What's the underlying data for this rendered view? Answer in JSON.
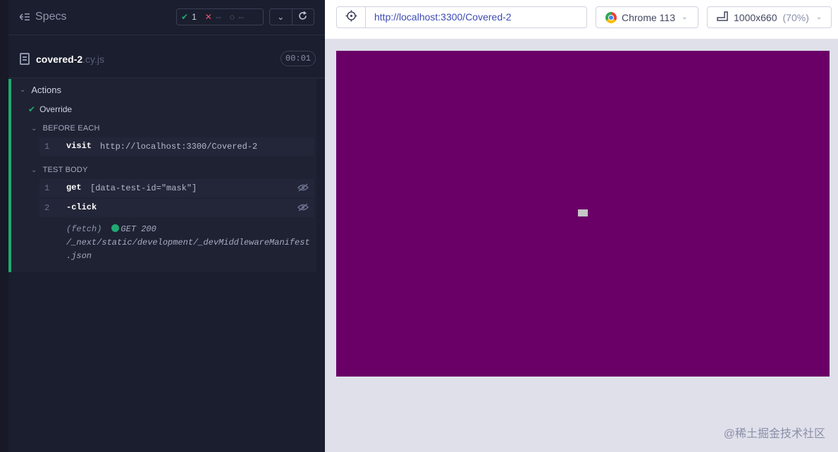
{
  "specs_header": {
    "title": "Specs",
    "passed": "1",
    "failed": "--",
    "pending": "--"
  },
  "spec_file": {
    "name": "covered-2",
    "ext": ".cy.js",
    "duration": "00:01"
  },
  "suite": {
    "title": "Actions",
    "test_title": "Override",
    "before_each": {
      "label": "BEFORE EACH",
      "commands": [
        {
          "number": "1",
          "name": "visit",
          "arg": "http://localhost:3300/Covered-2"
        }
      ]
    },
    "test_body": {
      "label": "TEST BODY",
      "commands": [
        {
          "number": "1",
          "name": "get",
          "arg": "[data-test-id=\"mask\"]"
        },
        {
          "number": "2",
          "name": "-click",
          "arg": ""
        }
      ],
      "log": {
        "tag": "(fetch)",
        "status": "GET 200",
        "path_line1": "/_next/static/development/_devMiddlewareManifest",
        "path_line2": ".json"
      }
    }
  },
  "browser_bar": {
    "url": "http://localhost:3300/Covered-2",
    "browser": "Chrome 113",
    "viewport": "1000x660",
    "viewport_scale": "(70%)"
  },
  "aut": {
    "background_color": "#6a0067",
    "box_color": "#c6c6c6"
  },
  "watermark": "@稀土掘金技术社区",
  "colors": {
    "pass": "#1fa971",
    "fail": "#e45770",
    "url": "#3c4ab5"
  }
}
